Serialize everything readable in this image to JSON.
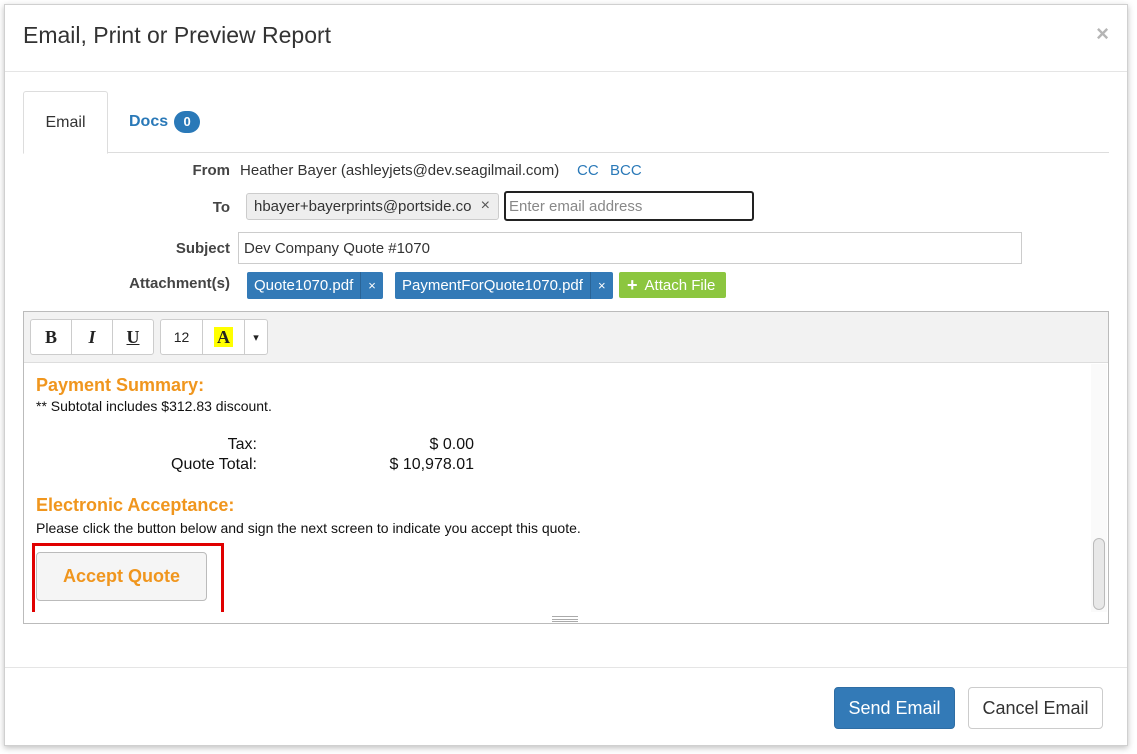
{
  "modal": {
    "title": "Email, Print or Preview Report",
    "close_icon": "×"
  },
  "tabs": [
    {
      "label": "Email",
      "active": true
    },
    {
      "label": "Docs",
      "badge": "0",
      "active": false
    }
  ],
  "form": {
    "from_label": "From",
    "from_value": "Heather Bayer (ashleyjets@dev.seagilmail.com)",
    "cc_label": "CC",
    "bcc_label": "BCC",
    "to_label": "To",
    "to_recipient": "hbayer+bayerprints@portside.co",
    "to_remove": "×",
    "to_placeholder": "Enter email address",
    "subject_label": "Subject",
    "subject_value": "Dev Company Quote #1070",
    "attachments_label": "Attachment(s)",
    "attachments": [
      {
        "name": "Quote1070.pdf",
        "remove": "×"
      },
      {
        "name": "PaymentForQuote1070.pdf",
        "remove": "×"
      }
    ],
    "attach_file_label": "Attach File",
    "attach_file_icon": "+"
  },
  "toolbar": {
    "bold": "B",
    "italic": "I",
    "underline": "U",
    "font_size": "12",
    "highlight": "A",
    "dropdown": "▾"
  },
  "editor": {
    "payment_summary_title": "Payment Summary:",
    "discount_note": "** Subtotal includes $312.83 discount.",
    "tax_label": "Tax:",
    "tax_value": "$ 0.00",
    "quote_total_label": "Quote Total:",
    "quote_total_value": "$ 10,978.01",
    "acceptance_title": "Electronic Acceptance:",
    "acceptance_text": "Please click the button below and sign the next screen to indicate you accept this quote.",
    "accept_button": "Accept Quote",
    "accent_color": "#f0961e"
  },
  "footer": {
    "send_label": "Send Email",
    "cancel_label": "Cancel Email"
  },
  "colors": {
    "primary": "#337ab7",
    "success": "#8cc63f",
    "highlight": "#e00000"
  }
}
